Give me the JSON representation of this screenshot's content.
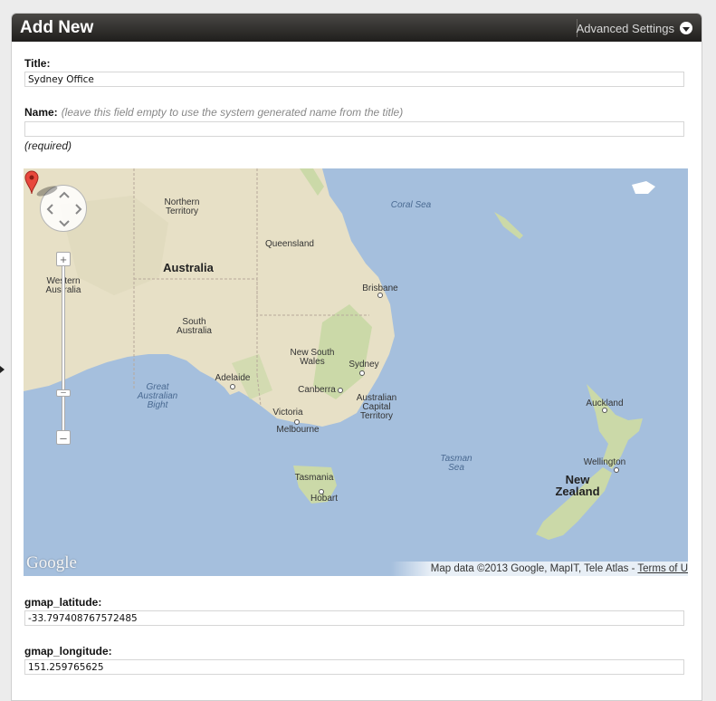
{
  "header": {
    "title": "Add New",
    "advanced_settings": "Advanced Settings"
  },
  "form": {
    "title_label": "Title:",
    "title_value": "Sydney Office",
    "name_label": "Name:",
    "name_hint": "(leave this field empty to use the system generated name from the title)",
    "name_value": "",
    "required_note": "(required)",
    "lat_label": "gmap_latitude:",
    "lat_value": "-33.797408767572485",
    "lng_label": "gmap_longitude:",
    "lng_value": "151.259765625"
  },
  "map": {
    "labels": {
      "northern_territory": "Northern Territory",
      "queensland": "Queensland",
      "australia": "Australia",
      "western_australia": "Western Australia",
      "south_australia": "South Australia",
      "new_south_wales": "New South Wales",
      "brisbane": "Brisbane",
      "sydney": "Sydney",
      "adelaide": "Adelaide",
      "canberra": "Canberra",
      "act": "Australian Capital Territory",
      "victoria": "Victoria",
      "melbourne": "Melbourne",
      "tasmania": "Tasmania",
      "hobart": "Hobart",
      "great_australian_bight": "Great Australian Bight",
      "coral_sea": "Coral Sea",
      "tasman_sea": "Tasman Sea",
      "auckland": "Auckland",
      "wellington": "Wellington",
      "new_zealand": "New Zealand"
    },
    "logo": "Google",
    "attribution": "Map data ©2013 Google, MapIT, Tele Atlas - ",
    "terms_link": "Terms of U",
    "colors": {
      "land": "#e7e0c6",
      "water": "#a5bfdd",
      "green": "#cbd9a8",
      "pin": "#e8483d"
    }
  }
}
